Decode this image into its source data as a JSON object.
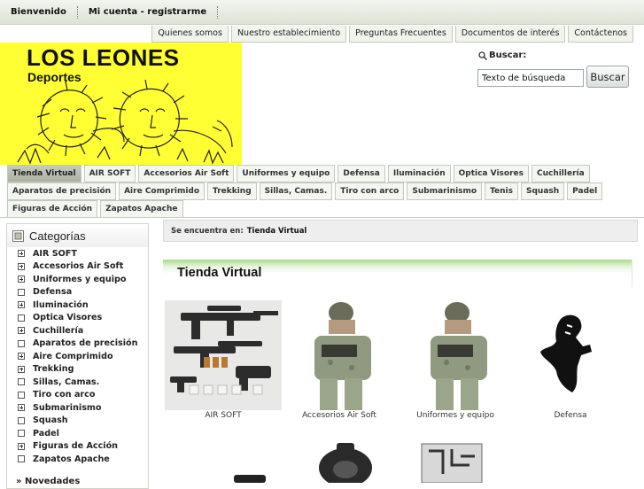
{
  "topbar": {
    "links": [
      "Bienvenido",
      "Mi cuenta - registrarme"
    ]
  },
  "secondary_nav": [
    "Quienes somos",
    "Nuestro establecimiento",
    "Preguntas Frecuentes",
    "Documentos de interés",
    "Contáctenos"
  ],
  "logo": {
    "title": "LOS LEONES",
    "subtitle": "Deportes"
  },
  "search": {
    "label": "Buscar:",
    "value": "Texto de búsqueda",
    "button": "Buscar"
  },
  "tabs": {
    "row1": [
      "Tienda Virtual",
      "AIR SOFT",
      "Accesorios Air Soft",
      "Uniformes y equipo",
      "Defensa",
      "Iluminación",
      "Optica Visores",
      "Cuchillería"
    ],
    "row2": [
      "Aparatos de precisión",
      "Aire Comprimido",
      "Trekking",
      "Sillas, Camas.",
      "Tiro con arco",
      "Submarinismo",
      "Tenis",
      "Squash",
      "Padel"
    ],
    "row3": [
      "Figuras de Acción",
      "Zapatos Apache"
    ],
    "active": "Tienda Virtual"
  },
  "sidebar": {
    "title": "Categorías",
    "items": [
      {
        "label": "AIR SOFT",
        "expandable": true
      },
      {
        "label": "Accesorios Air Soft",
        "expandable": true
      },
      {
        "label": "Uniformes y equipo",
        "expandable": true
      },
      {
        "label": "Defensa",
        "expandable": false
      },
      {
        "label": "Iluminación",
        "expandable": true
      },
      {
        "label": "Optica Visores",
        "expandable": false
      },
      {
        "label": "Cuchillería",
        "expandable": true
      },
      {
        "label": "Aparatos de precisión",
        "expandable": false
      },
      {
        "label": "Aire Comprimido",
        "expandable": true
      },
      {
        "label": "Trekking",
        "expandable": true
      },
      {
        "label": "Sillas, Camas.",
        "expandable": false
      },
      {
        "label": "Tiro con arco",
        "expandable": false
      },
      {
        "label": "Submarinismo",
        "expandable": true
      },
      {
        "label": "Squash",
        "expandable": false
      },
      {
        "label": "Padel",
        "expandable": false
      },
      {
        "label": "Figuras de Acción",
        "expandable": true
      },
      {
        "label": "Zapatos Apache",
        "expandable": false
      }
    ],
    "next_section": "Novedades"
  },
  "breadcrumb": {
    "label": "Se encuentra en:",
    "current": "Tienda Virtual"
  },
  "page": {
    "title": "Tienda Virtual"
  },
  "products": [
    "AIR SOFT",
    "Accesorios Air Soft",
    "Uniformes y equipo",
    "Defensa"
  ],
  "colors": {
    "logo_bg": "#ffff33",
    "heading_green": "#a9da86",
    "tab_active": "#b4bcad"
  }
}
